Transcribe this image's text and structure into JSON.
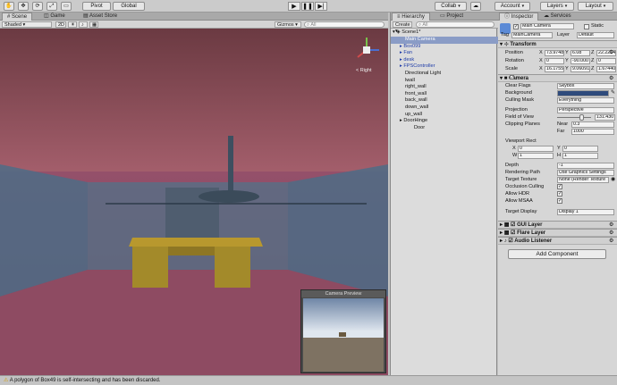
{
  "toolbar": {
    "pivot": "Pivot",
    "global": "Global",
    "collab": "Collab",
    "account": "Account",
    "layers": "Layers",
    "layout": "Layout"
  },
  "scene_panel": {
    "tabs": [
      "Scene",
      "Game",
      "Asset Store"
    ],
    "shading": "Shaded",
    "mode_2d": "2D",
    "gizmos": "Gizmos",
    "search_placeholder": "All",
    "gizmo_label": "< Right",
    "camera_preview_title": "Camera Preview"
  },
  "hierarchy": {
    "tabs": [
      "Hierarchy",
      "Project"
    ],
    "create": "Create",
    "search_placeholder": "All",
    "scene_name": "Scene1*",
    "items": [
      {
        "label": "Main Camera",
        "selected": true,
        "indent": 1
      },
      {
        "label": "Box099",
        "prefab": true,
        "expand": true,
        "indent": 1
      },
      {
        "label": "Fan",
        "prefab": true,
        "expand": true,
        "indent": 1
      },
      {
        "label": "desk",
        "prefab": true,
        "expand": true,
        "indent": 1
      },
      {
        "label": "FPSController",
        "prefab": true,
        "expand": true,
        "indent": 1
      },
      {
        "label": "Directional Light",
        "indent": 1
      },
      {
        "label": "lwall",
        "indent": 1
      },
      {
        "label": "right_wall",
        "indent": 1
      },
      {
        "label": "front_wall",
        "indent": 1
      },
      {
        "label": "back_wall",
        "indent": 1
      },
      {
        "label": "down_wall",
        "indent": 1
      },
      {
        "label": "up_wall",
        "indent": 1
      },
      {
        "label": "DoorHinge",
        "expand": true,
        "indent": 1
      },
      {
        "label": "Door",
        "indent": 2
      }
    ]
  },
  "inspector": {
    "tabs": [
      "Inspector",
      "Services"
    ],
    "object_name": "Main Camera",
    "static_label": "Static",
    "tag_label": "Tag",
    "tag_value": "MainCamera",
    "layer_label": "Layer",
    "layer_value": "Default",
    "transform": {
      "title": "Transform",
      "position_label": "Position",
      "rotation_label": "Rotation",
      "scale_label": "Scale",
      "position": [
        "73.9748",
        "6.08",
        "22.2214"
      ],
      "rotation": [
        "0",
        "-90.000",
        "0"
      ],
      "scale": [
        "16.1755",
        "9.06091",
        "1.67440"
      ]
    },
    "camera": {
      "title": "Camera",
      "clear_flags_label": "Clear Flags",
      "clear_flags_value": "Skybox",
      "background_label": "Background",
      "background_color": "#2f4b7c",
      "culling_mask_label": "Culling Mask",
      "culling_mask_value": "Everything",
      "projection_label": "Projection",
      "projection_value": "Perspective",
      "fov_label": "Field of View",
      "fov_value": "131.430",
      "fov_fraction": 0.73,
      "clipping_label": "Clipping Planes",
      "near_label": "Near",
      "near_value": "0.3",
      "far_label": "Far",
      "far_value": "1000",
      "viewport_label": "Viewport Rect",
      "vp_x": "0",
      "vp_y": "0",
      "vp_w": "1",
      "vp_h": "1",
      "depth_label": "Depth",
      "depth_value": "-1",
      "rendering_path_label": "Rendering Path",
      "rendering_path_value": "Use Graphics Settings",
      "target_texture_label": "Target Texture",
      "target_texture_value": "None (Render Texture",
      "occlusion_label": "Occlusion Culling",
      "hdr_label": "Allow HDR",
      "msaa_label": "Allow MSAA",
      "target_display_label": "Target Display",
      "target_display_value": "Display 1"
    },
    "components": [
      "GUI Layer",
      "Flare Layer",
      "Audio Listener"
    ],
    "add_component": "Add Component"
  },
  "status": {
    "message": "A polygon of Box49 is self-intersecting and has been discarded."
  },
  "colors": {
    "sky_top": "#6e3c44",
    "sky_bottom": "#9e5a66",
    "floor": "#8a4a5e",
    "wall": "#4f6a82",
    "desk": "#a08a2a",
    "selection": "#8a9cc6"
  }
}
